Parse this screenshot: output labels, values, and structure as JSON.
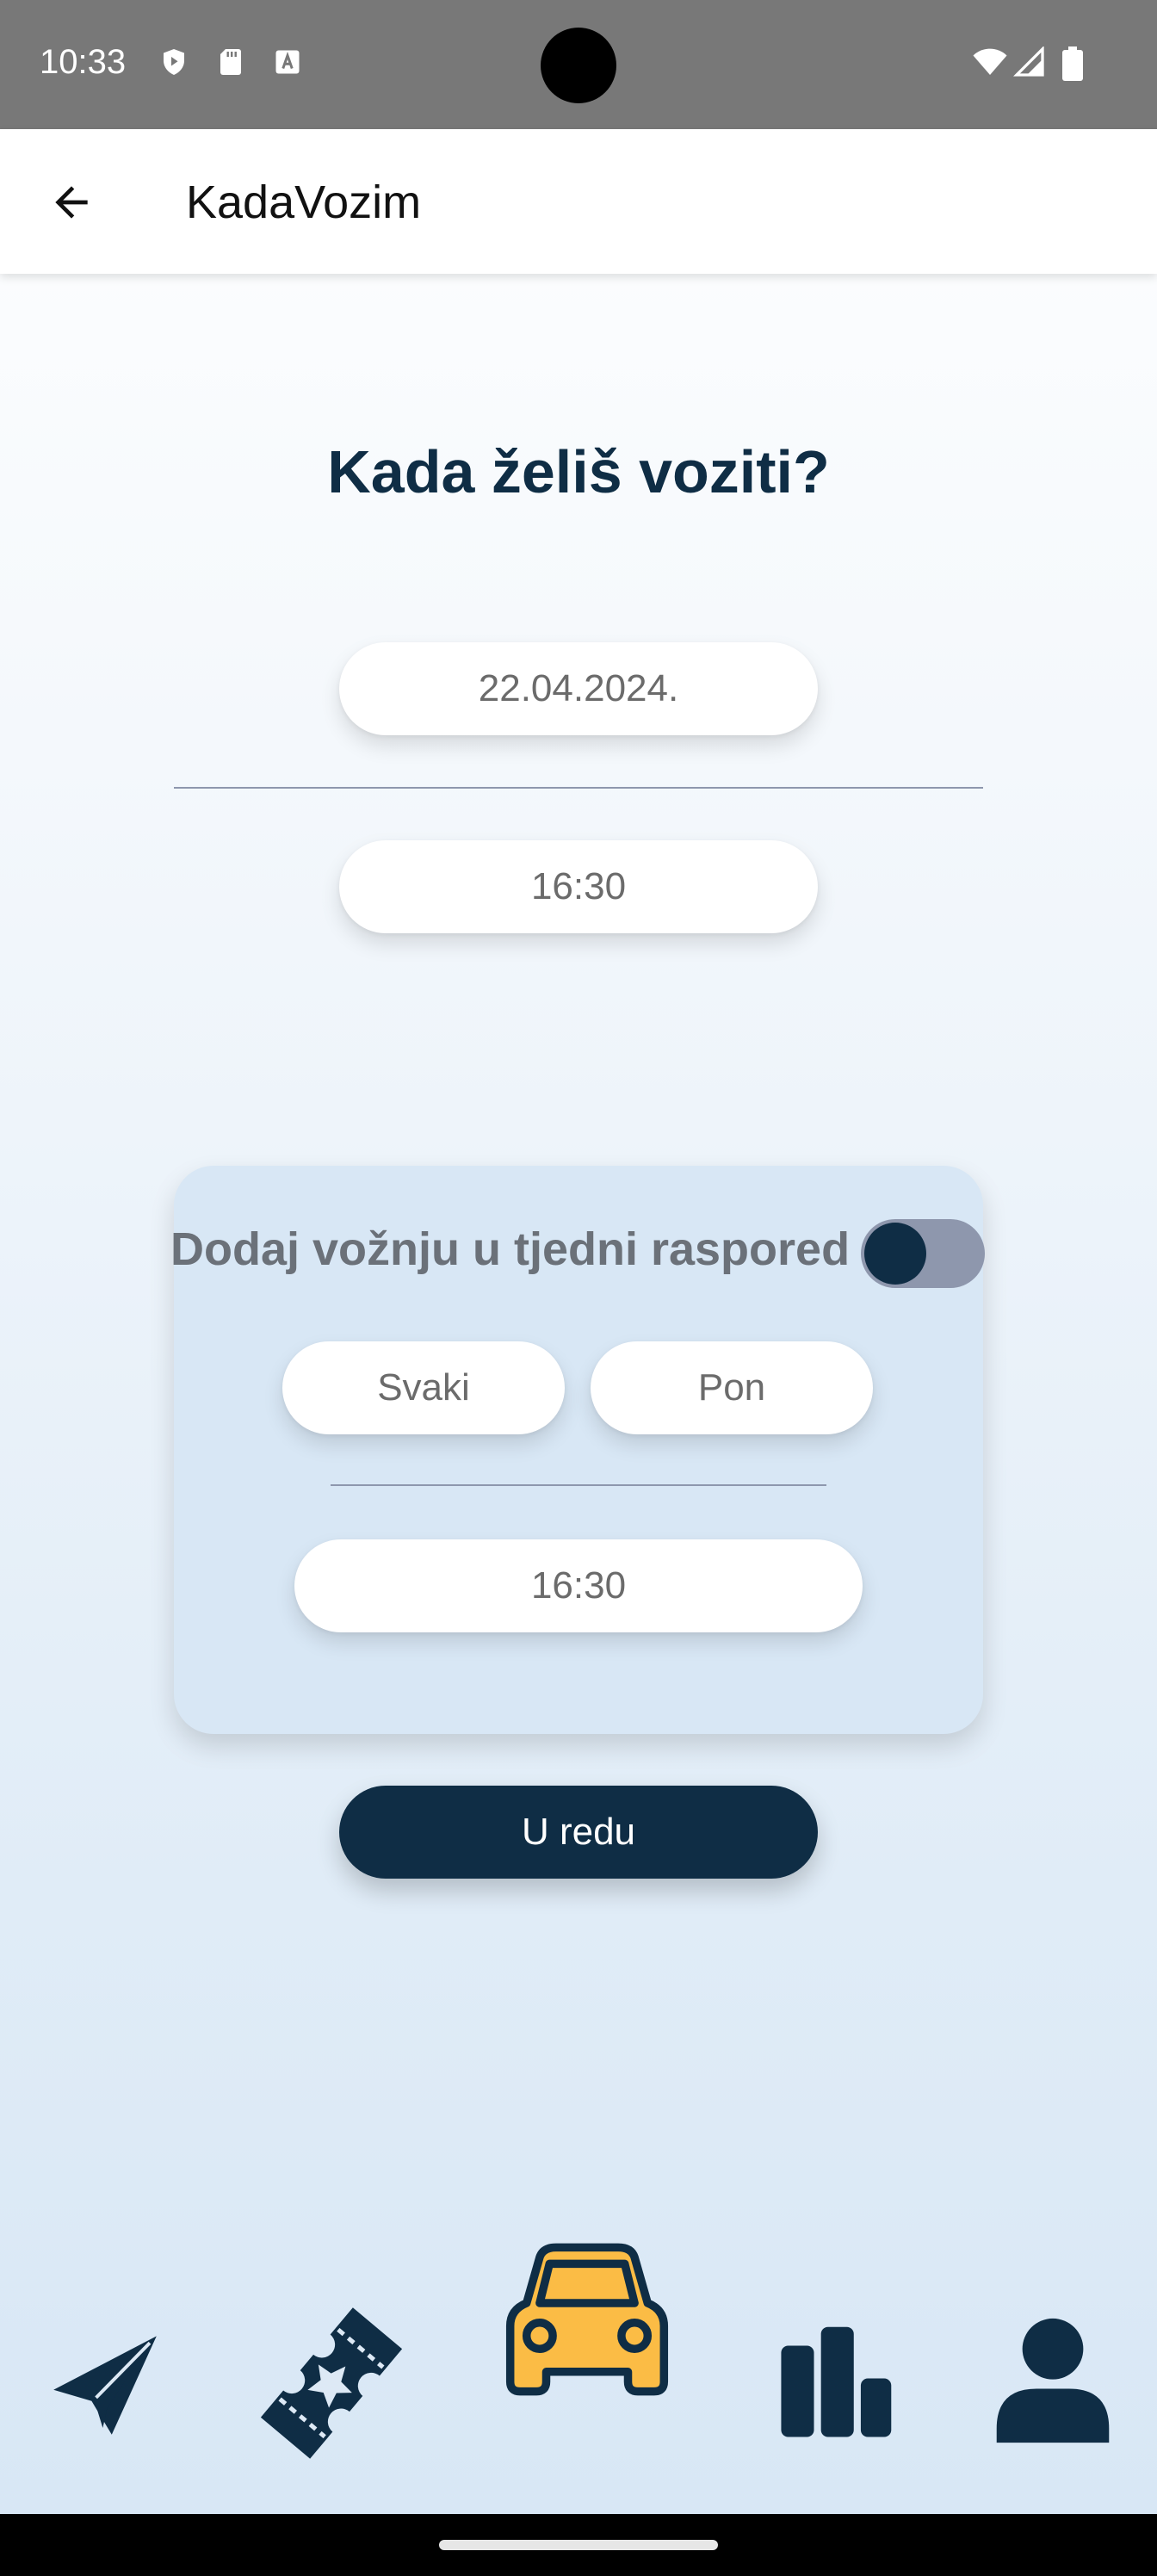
{
  "status_bar": {
    "time": "10:33",
    "left_icons": [
      "shield-icon",
      "sd-card-icon",
      "text-a-icon"
    ],
    "right_icons": [
      "wifi-icon",
      "signal-icon",
      "battery-icon"
    ]
  },
  "app_bar": {
    "back_icon": "arrow-left-icon",
    "title": "KadaVozim"
  },
  "main": {
    "heading": "Kada želiš voziti?",
    "date_value": "22.04.2024.",
    "time_value": "16:30"
  },
  "weekly": {
    "label": "Dodaj vožnju u tjedni raspored",
    "toggle_on": false,
    "frequency_value": "Svaki",
    "day_value": "Pon",
    "time_value": "16:30"
  },
  "confirm_label": "U redu",
  "bottom_nav": {
    "items": [
      "paper-plane-icon",
      "ticket-icon",
      "car-icon",
      "bar-chart-icon",
      "person-icon"
    ],
    "active": "car-icon"
  },
  "colors": {
    "primary": "#0f2d45",
    "accent": "#fbbc45",
    "toggle_track": "#8e97ad",
    "card_bg": "#d8e7f5"
  }
}
